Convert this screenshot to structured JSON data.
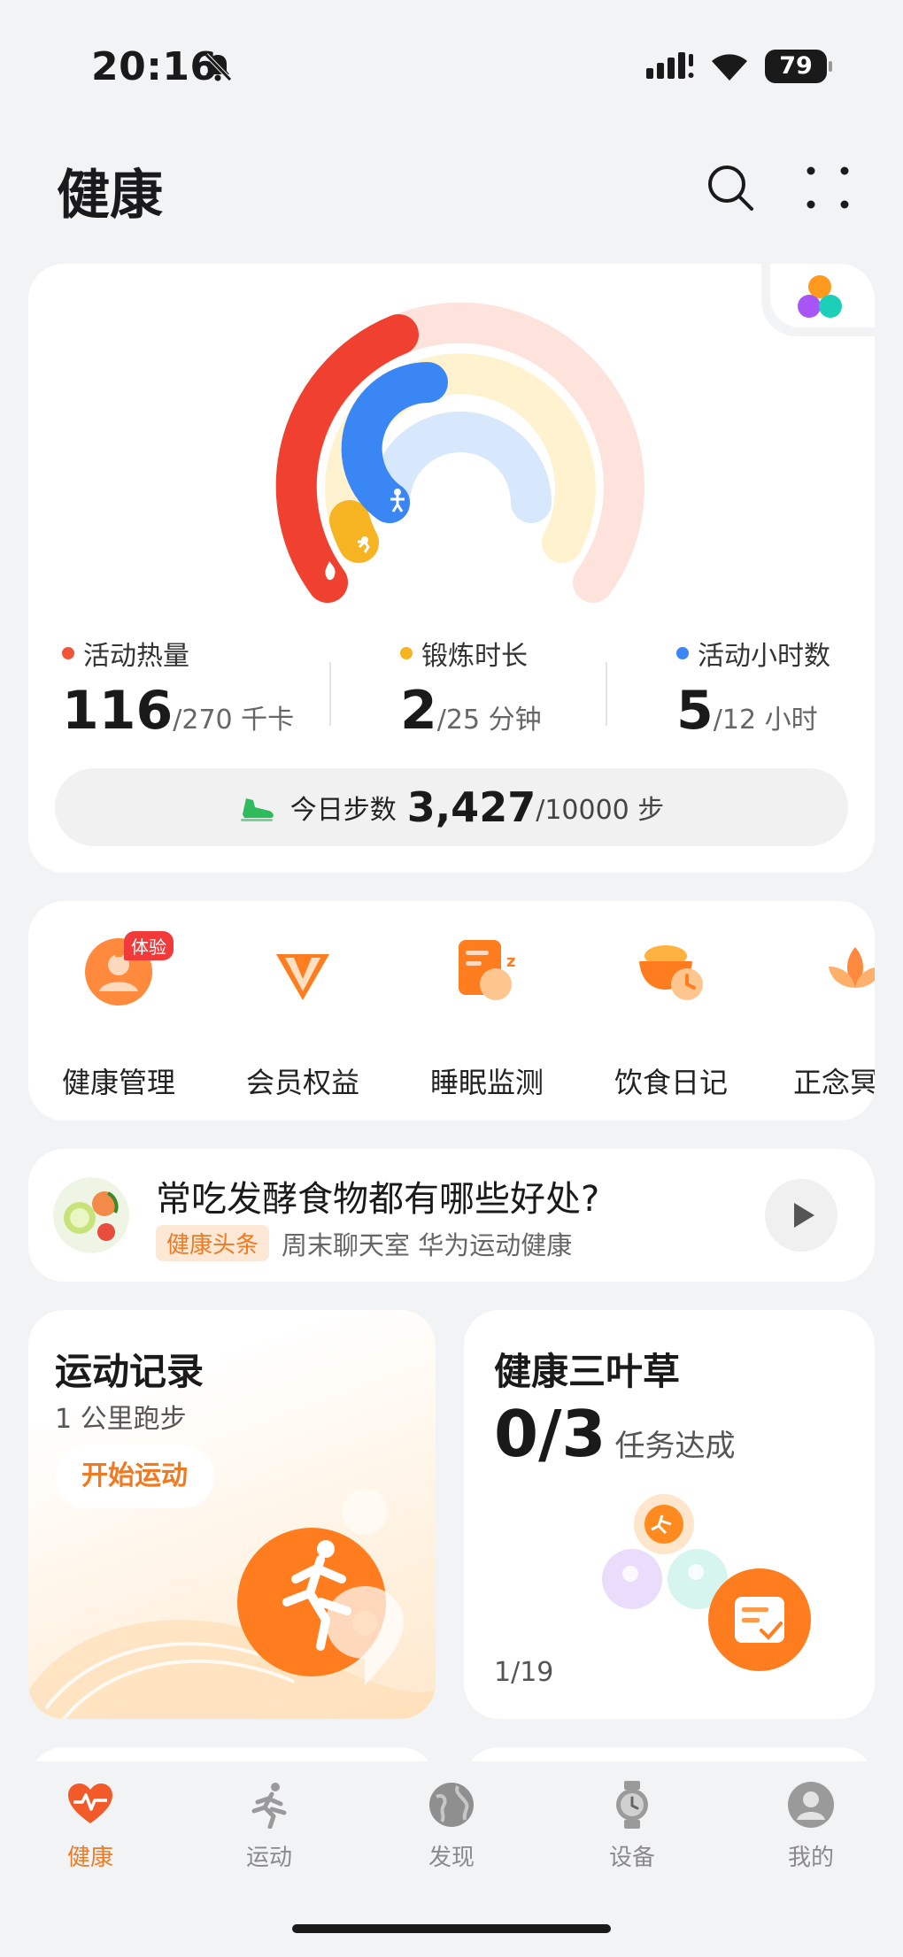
{
  "status_bar": {
    "time": "20:16",
    "battery": "79"
  },
  "header": {
    "title": "健康"
  },
  "activity": {
    "metrics": [
      {
        "label": "活动热量",
        "value": "116",
        "total": "/270 千卡",
        "color": "#f0553a"
      },
      {
        "label": "锻炼时长",
        "value": "2",
        "total": "/25 分钟",
        "color": "#f7b422"
      },
      {
        "label": "活动小时数",
        "value": "5",
        "total": "/12 小时",
        "color": "#3a86f5"
      }
    ],
    "steps": {
      "label": "今日步数",
      "value": "3,427",
      "total": "/10000 步"
    }
  },
  "shortcuts": [
    {
      "label": "健康管理",
      "icon": "health-management-icon",
      "badge": "体验"
    },
    {
      "label": "会员权益",
      "icon": "vip-icon"
    },
    {
      "label": "睡眠监测",
      "icon": "sleep-icon"
    },
    {
      "label": "饮食日记",
      "icon": "diet-icon"
    },
    {
      "label": "正念冥",
      "icon": "lotus-icon"
    }
  ],
  "article": {
    "title": "常吃发酵食物都有哪些好处?",
    "tag": "健康头条",
    "source": "周末聊天室 华为运动健康"
  },
  "sport_record": {
    "title": "运动记录",
    "subtitle": "1 公里跑步",
    "button": "开始运动"
  },
  "clover": {
    "title": "健康三叶草",
    "value": "0/3",
    "text": "任务达成",
    "page": "1/19"
  },
  "tabs": [
    {
      "label": "健康",
      "icon": "heart-icon",
      "active": true
    },
    {
      "label": "运动",
      "icon": "runner-icon",
      "active": false
    },
    {
      "label": "发现",
      "icon": "globe-icon",
      "active": false
    },
    {
      "label": "设备",
      "icon": "watch-icon",
      "active": false
    },
    {
      "label": "我的",
      "icon": "profile-icon",
      "active": false
    }
  ],
  "colors": {
    "accent": "#f07a22",
    "calories": "#f0553a",
    "exercise": "#f7b422",
    "hours": "#3a86f5"
  }
}
